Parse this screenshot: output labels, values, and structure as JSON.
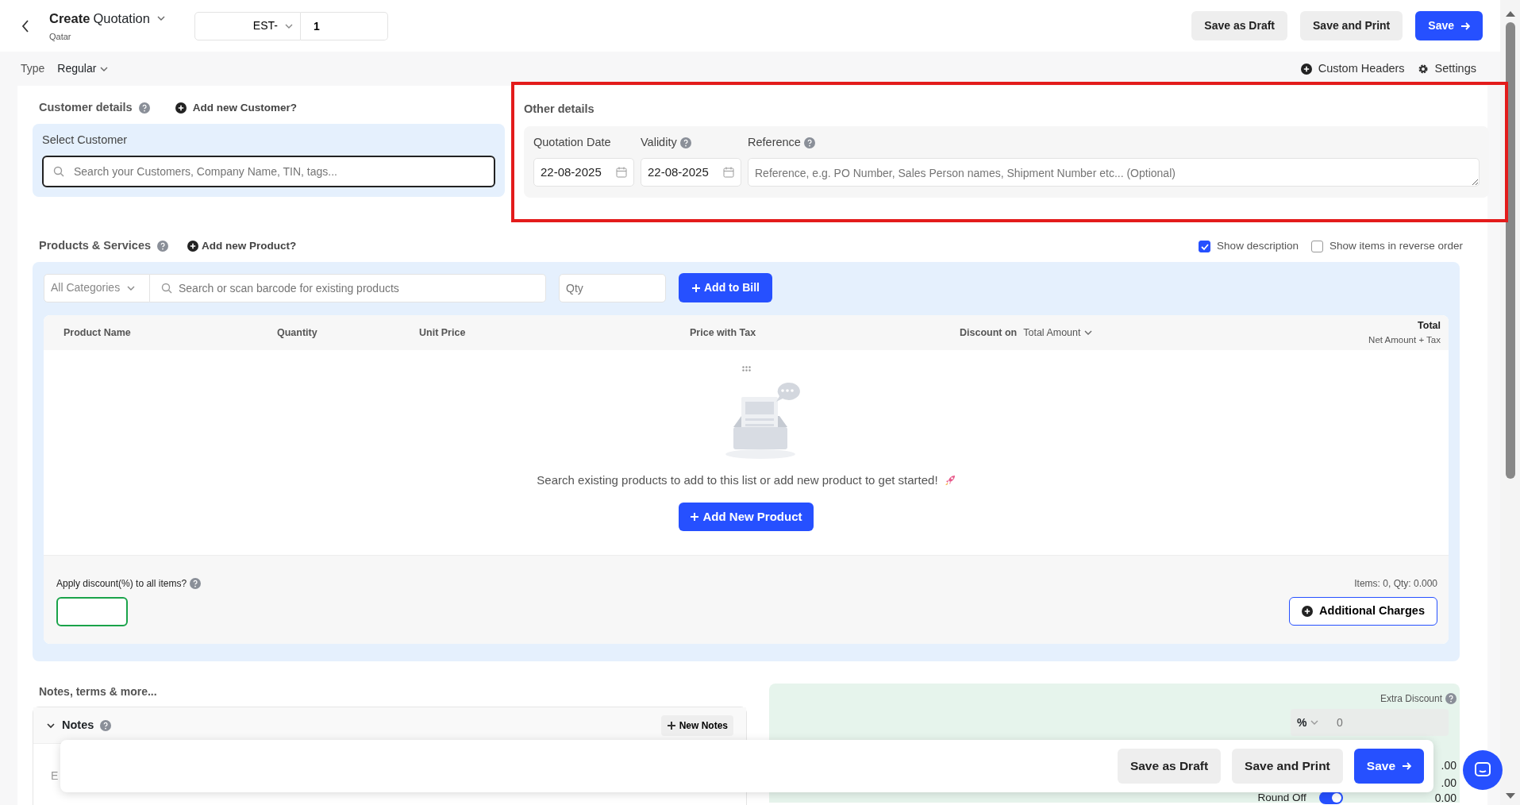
{
  "header": {
    "title": "Create",
    "doc_type": "Quotation",
    "subtitle": "Qatar",
    "prefix": "EST-",
    "number": "1",
    "buttons": [
      {
        "label": "Save as Draft",
        "kind": "secondary"
      },
      {
        "label": "Save and Print",
        "kind": "secondary"
      },
      {
        "label": "Save",
        "kind": "primary"
      }
    ]
  },
  "type_bar": {
    "label": "Type",
    "value": "Regular",
    "links": [
      {
        "label": "Custom Headers",
        "kind": "plus"
      },
      {
        "label": "Settings",
        "kind": "gear"
      }
    ]
  },
  "customer": {
    "title": "Customer details",
    "add_link": "Add new Customer?",
    "field_label": "Select Customer",
    "placeholder": "Search your Customers, Company Name, TIN, tags..."
  },
  "other_details": {
    "title": "Other details",
    "highlighted": true,
    "fields": [
      {
        "kind": "date",
        "label": "Quotation Date",
        "help": false,
        "value": "22-08-2025"
      },
      {
        "kind": "date",
        "label": "Validity",
        "help": true,
        "value": "22-08-2025"
      },
      {
        "kind": "textarea",
        "label": "Reference",
        "help": true,
        "placeholder": "Reference, e.g. PO Number, Sales Person names, Shipment Number etc... (Optional)"
      }
    ]
  },
  "products": {
    "title": "Products & Services",
    "add_link": "Add new Product?",
    "options": [
      {
        "label": "Show description",
        "checked": true
      },
      {
        "label": "Show items in reverse order",
        "checked": false
      }
    ],
    "category": "All Categories",
    "search_placeholder": "Search or scan barcode for existing products",
    "qty_placeholder": "Qty",
    "add_button": "Add to Bill",
    "columns": [
      "Product Name",
      "Quantity",
      "Unit Price",
      "Price with Tax"
    ],
    "discount_label": "Discount on",
    "discount_value": "Total Amount",
    "total_title": "Total",
    "total_sub": "Net Amount + Tax",
    "empty_message": "Search existing products to add to this list or add new product to get started!",
    "empty_button": "Add New Product",
    "discount_all_label": "Apply discount(%) to all items?",
    "summary": "Items: 0, Qty: 0.000",
    "charges_button": "Additional Charges"
  },
  "notes": {
    "title": "Notes, terms & more...",
    "panel": "Notes",
    "expanded": true,
    "new_button": "New Notes",
    "partial_text": "E"
  },
  "totals": {
    "extra_discount_label": "Extra Discount",
    "unit": "%",
    "discount_placeholder": "0",
    "amounts": [
      ".00",
      ".00"
    ],
    "round_off_label": "Round Off",
    "round_off_on": true,
    "round_off_value": "0.00"
  },
  "action_bar": {
    "buttons": [
      {
        "label": "Save as Draft",
        "kind": "secondary"
      },
      {
        "label": "Save and Print",
        "kind": "secondary"
      },
      {
        "label": "Save",
        "kind": "primary"
      }
    ]
  }
}
